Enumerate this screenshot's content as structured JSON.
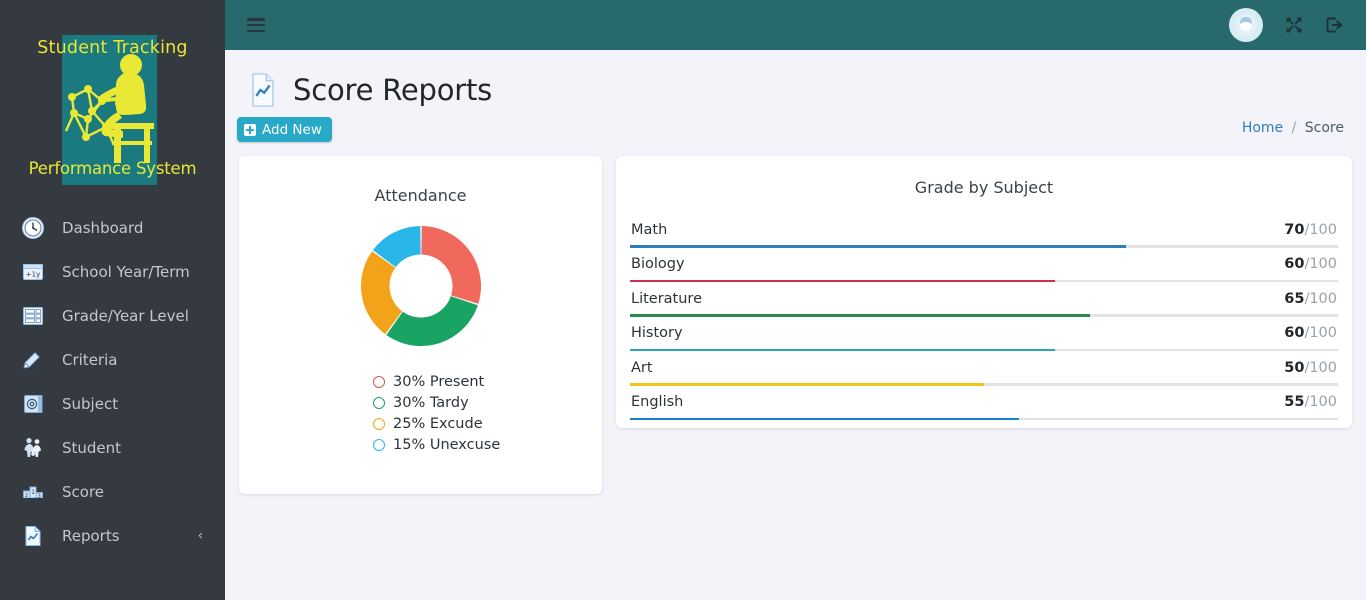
{
  "brand": {
    "line1": "Student Tracking",
    "line2": "Performance System",
    "logo_icon": "student-at-desk-icon"
  },
  "sidebar": {
    "items": [
      {
        "label": "Dashboard",
        "icon": "clock-icon"
      },
      {
        "label": "School Year/Term",
        "icon": "calendar-plus-year-icon"
      },
      {
        "label": "Grade/Year Level",
        "icon": "grid-list-icon"
      },
      {
        "label": "Criteria",
        "icon": "pencil-down-arrow-icon"
      },
      {
        "label": "Subject",
        "icon": "book-icon"
      },
      {
        "label": "Student",
        "icon": "people-icon"
      },
      {
        "label": "Score",
        "icon": "podium-icon"
      },
      {
        "label": "Reports",
        "icon": "document-chart-icon",
        "chevron": "‹"
      }
    ]
  },
  "topbar": {
    "menu_icon": "hamburger-icon",
    "avatar_icon": "user-avatar-icon",
    "fullscreen_icon": "expand-arrows-icon",
    "logout_icon": "logout-icon",
    "background_color": "#27696c"
  },
  "page": {
    "title": "Score Reports",
    "title_icon": "document-chart-icon",
    "add_new_label": "Add New",
    "add_new_icon": "plus-square-icon",
    "add_new_color": "#28a9c8",
    "background_color": "#f4f3fa"
  },
  "breadcrumb": {
    "home": "Home",
    "separator": "/",
    "current": "Score"
  },
  "chart_data": [
    {
      "type": "pie",
      "title": "Attendance",
      "donut": true,
      "categories": [
        "Present",
        "Tardy",
        "Excude",
        "Unexcuse"
      ],
      "values": [
        30,
        30,
        25,
        15
      ],
      "colors": [
        "#f1695c",
        "#19a463",
        "#f3a31a",
        "#29b6e8"
      ],
      "legend": [
        {
          "label": "30% Present",
          "color": "#d9534f"
        },
        {
          "label": "30% Tardy",
          "color": "#19a463"
        },
        {
          "label": "25% Excude",
          "color": "#f3a31a"
        },
        {
          "label": "15% Unexcuse",
          "color": "#29b6e8"
        }
      ],
      "legend_position": "bottom"
    },
    {
      "type": "bar",
      "title": "Grade by Subject",
      "orientation": "horizontal",
      "categories": [
        "Math",
        "Biology",
        "Literature",
        "History",
        "Art",
        "English"
      ],
      "values": [
        70,
        60,
        65,
        60,
        50,
        55
      ],
      "max": 100,
      "suffix": "/100",
      "colors": [
        "#2e7ebc",
        "#c9344a",
        "#2b8a4f",
        "#2ba6bb",
        "#f0c419",
        "#1b7fd4"
      ],
      "rows": [
        {
          "name": "Math",
          "value": 70,
          "suffix": "/100",
          "color": "#2e7ebc"
        },
        {
          "name": "Biology",
          "value": 60,
          "suffix": "/100",
          "color": "#c9344a"
        },
        {
          "name": "Literature",
          "value": 65,
          "suffix": "/100",
          "color": "#2b8a4f"
        },
        {
          "name": "History",
          "value": 60,
          "suffix": "/100",
          "color": "#2ba6bb"
        },
        {
          "name": "Art",
          "value": 50,
          "suffix": "/100",
          "color": "#f0c419"
        },
        {
          "name": "English",
          "value": 55,
          "suffix": "/100",
          "color": "#1b7fd4"
        }
      ]
    }
  ]
}
